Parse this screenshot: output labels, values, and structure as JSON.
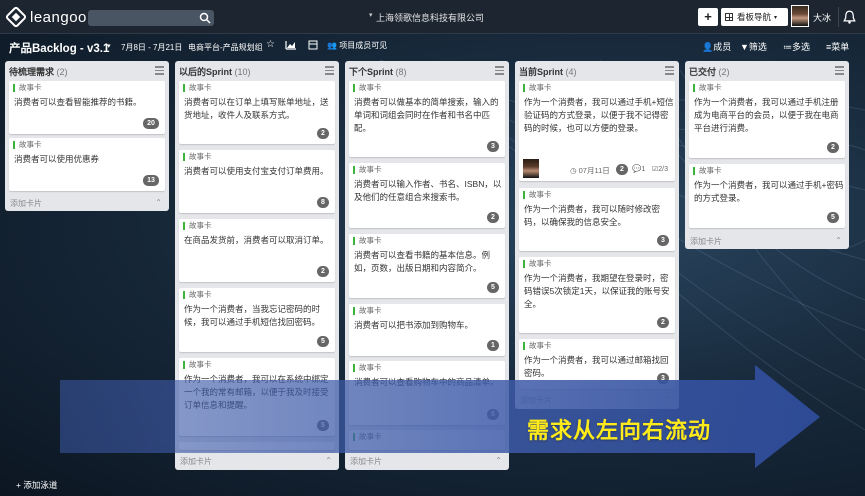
{
  "app": {
    "logo_text": "leangoo",
    "organization": "上海领歌信息科技有限公司",
    "nav_button": "看板导航",
    "user_name": "大冰",
    "plus_label": "+"
  },
  "board": {
    "title": "产品Backlog - v3.1",
    "date_range": "7月8日 - 7月21日",
    "category": "电商平台-产品规划组",
    "member_visibility": "项目成员可见",
    "actions": {
      "members": "成员",
      "filter": "筛选",
      "multi_select": "多选",
      "menu": "菜单"
    },
    "add_card_label": "添加卡片",
    "add_lane_label": "+ 添加泳道"
  },
  "card_type": "故事卡",
  "lists": [
    {
      "title": "待梳理需求",
      "count": "(2)",
      "cards": [
        {
          "text": "消费者可以查看智能推荐的书籍。",
          "badge": "20"
        },
        {
          "text": "消费者可以使用优惠券",
          "badge": "13"
        }
      ]
    },
    {
      "title": "以后的Sprint",
      "count": "(10)",
      "cards": [
        {
          "text": "消费者可以在订单上填写账单地址，送货地址，收件人及联系方式。",
          "badge": "2"
        },
        {
          "text": "消费者可以使用支付宝支付订单费用。",
          "badge": "8"
        },
        {
          "text": "在商品发货前，消费者可以取消订单。",
          "badge": "2"
        },
        {
          "text": "作为一个消费者，当我忘记密码的时候，我可以通过手机短信找回密码。",
          "badge": "5"
        },
        {
          "text": "作为一个消费者，我可以在系统中绑定一个我的常有邮箱，以便于我及时接受订单信息和提醒。",
          "badge": "5"
        }
      ]
    },
    {
      "title": "下个Sprint",
      "count": "(8)",
      "cards": [
        {
          "text": "消费者可以做基本的简单搜索，输入的单词和词组会同时在作者和书名中匹配。",
          "badge": "3"
        },
        {
          "text": "消费者可以输入作者、书名、ISBN，以及他们的任意组合来搜索书。",
          "badge": "2"
        },
        {
          "text": "消费者可以查看书籍的基本信息。例如，页数，出版日期和内容简介。",
          "badge": "5"
        },
        {
          "text": "消费者可以把书添加到购物车。",
          "badge": "1"
        },
        {
          "text": "消费者可以查看购物车中的商品清单。",
          "badge": "5"
        }
      ]
    },
    {
      "title": "当前Sprint",
      "count": "(4)",
      "cards": [
        {
          "text": "作为一个消费者，我可以通过手机+短信验证码的方式登录，以便于我不记得密码的时候，也可以方便的登录。",
          "badge": "",
          "date": "07月11日",
          "comment_badge": "2",
          "comments": "1",
          "checklist": "2/3"
        },
        {
          "text": "作为一个消费者，我可以随时修改密码，以确保我的信息安全。",
          "badge": "3"
        },
        {
          "text": "作为一个消费者，我期望在登录时，密码错误5次锁定1天，以保证我的账号安全。",
          "badge": "2"
        },
        {
          "text": "作为一个消费者，我可以通过邮箱找回密码。",
          "badge": "3"
        }
      ]
    },
    {
      "title": "已交付",
      "count": "(2)",
      "cards": [
        {
          "text": "作为一个消费者，我可以通过手机注册成为电商平台的会员，以便于我在电商平台进行消费。",
          "badge": "2"
        },
        {
          "text": "作为一个消费者，我可以通过手机+密码的方式登录。",
          "badge": "5"
        }
      ]
    }
  ],
  "overlay": {
    "text": "需求从左向右流动",
    "text_color": "#ffeb1a",
    "arrow_color": "#3d5aa8"
  },
  "colors": {
    "topbar": "#1c2530",
    "list_bg": "#e4e6ea",
    "tag_green": "#3cb43c",
    "badge_gray": "#666666"
  }
}
